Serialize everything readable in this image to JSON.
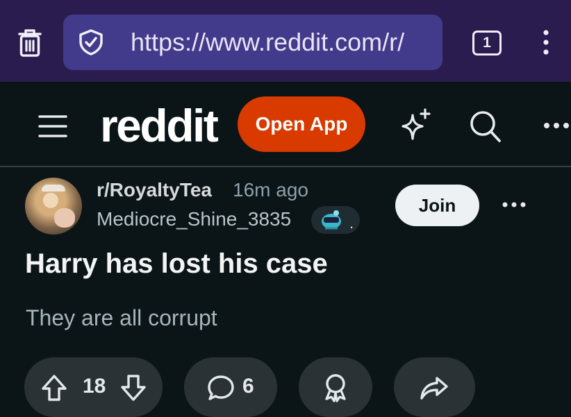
{
  "browser": {
    "url": "https://www.reddit.com/r/",
    "tab_count": "1",
    "icons": [
      "trash-icon",
      "shield-icon",
      "tabs-counter-icon",
      "more-vertical-icon"
    ]
  },
  "header": {
    "logo_text": "reddit",
    "open_app_label": "Open App",
    "icons": [
      "menu-icon",
      "sparkle-icon",
      "search-icon",
      "more-horizontal-icon"
    ]
  },
  "post": {
    "subreddit": "r/RoyaltyTea",
    "time_ago": "16m ago",
    "author": "Mediocre_Shine_3835",
    "flair_suffix": ".",
    "join_label": "Join",
    "title": "Harry has lost his case",
    "body": "They are all corrupt",
    "actions": {
      "vote_count": "18",
      "comment_count": "6"
    }
  },
  "colors": {
    "browser_bg": "#2a1c4f",
    "url_bg": "#423a8a",
    "page_bg": "#0b1416",
    "accent": "#d93a00",
    "pill_bg": "#2a3236"
  }
}
